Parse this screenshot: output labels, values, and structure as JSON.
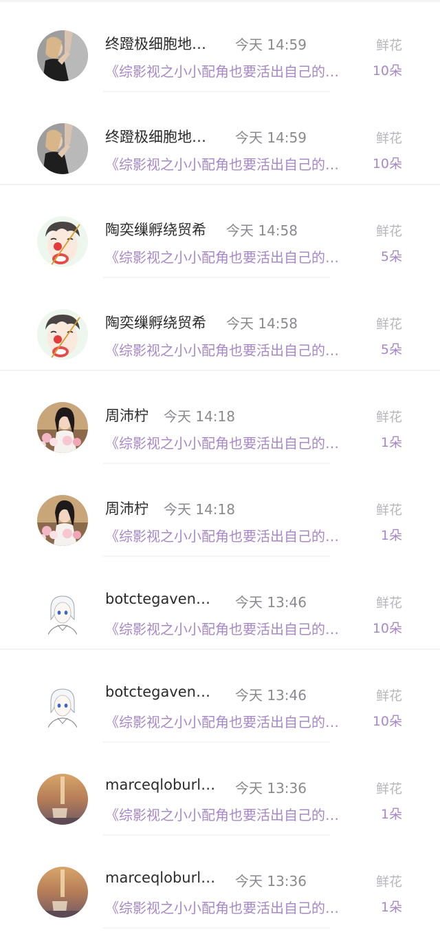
{
  "colors": {
    "accent": "#a887c9",
    "name_text": "#2b2b2b",
    "time_text": "#8a8a8e",
    "kind_text": "#b7b7bb",
    "divider": "#f2f2f4"
  },
  "records": [
    {
      "name": "终蹬极细胞地…",
      "time": "今天 14:59",
      "kind": "鲜花",
      "book": "《综影视之小小配角也要活出自己的…",
      "count": "10朵",
      "avatar": "woman-arm-raised-avatar"
    },
    {
      "name": "终蹬极细胞地…",
      "time": "今天 14:59",
      "kind": "鲜花",
      "book": "《综影视之小小配角也要活出自己的…",
      "count": "10朵",
      "avatar": "woman-arm-raised-avatar"
    },
    {
      "name": "陶奕缫孵绕贸希",
      "time": "今天 14:58",
      "kind": "鲜花",
      "book": "《综影视之小小配角也要活出自己的…",
      "count": "5朵",
      "avatar": "clown-boy-avatar"
    },
    {
      "name": "陶奕缫孵绕贸希",
      "time": "今天 14:58",
      "kind": "鲜花",
      "book": "《综影视之小小配角也要活出自己的…",
      "count": "5朵",
      "avatar": "clown-boy-avatar"
    },
    {
      "name": "周沛柠",
      "time": "今天 14:18",
      "kind": "鲜花",
      "book": "《综影视之小小配角也要活出自己的…",
      "count": "1朵",
      "avatar": "girl-flowers-avatar"
    },
    {
      "name": "周沛柠",
      "time": "今天 14:18",
      "kind": "鲜花",
      "book": "《综影视之小小配角也要活出自己的…",
      "count": "1朵",
      "avatar": "girl-flowers-avatar"
    },
    {
      "name": "botctegaven…",
      "time": "今天 13:46",
      "kind": "鲜花",
      "book": "《综影视之小小配角也要活出自己的…",
      "count": "10朵",
      "avatar": "anime-boy-avatar"
    },
    {
      "name": "botctegaven…",
      "time": "今天 13:46",
      "kind": "鲜花",
      "book": "《综影视之小小配角也要活出自己的…",
      "count": "10朵",
      "avatar": "anime-boy-avatar"
    },
    {
      "name": "marceqloburl…",
      "time": "今天 13:36",
      "kind": "鲜花",
      "book": "《综影视之小小配角也要活出自己的…",
      "count": "1朵",
      "avatar": "sunset-glass-avatar"
    },
    {
      "name": "marceqloburl…",
      "time": "今天 13:36",
      "kind": "鲜花",
      "book": "《综影视之小小配角也要活出自己的…",
      "count": "1朵",
      "avatar": "sunset-glass-avatar"
    }
  ]
}
